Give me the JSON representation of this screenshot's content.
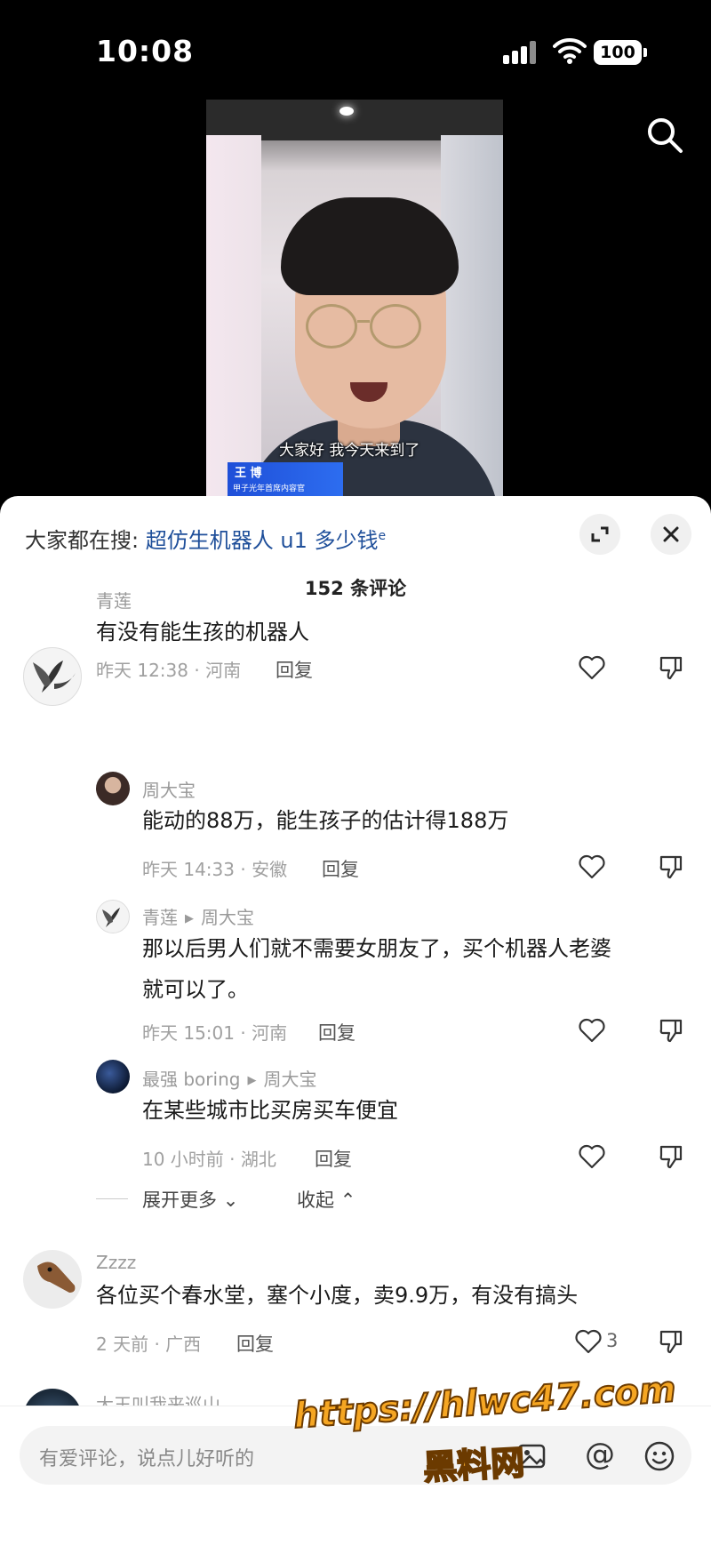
{
  "status_bar": {
    "time": "10:08",
    "battery": "100"
  },
  "video": {
    "subtitle": "大家好 我今天来到了",
    "name_tag": {
      "name": "王 博",
      "org": "甲子光年首席内容官"
    }
  },
  "sheet": {
    "hot_search_label": "大家都在搜:",
    "hot_search_keyword": "超仿生机器人 u1 多少钱",
    "comment_count": "152 条评论"
  },
  "comments": [
    {
      "user": "青莲",
      "text": "有没有能生孩的机器人",
      "meta": "昨天 12:38 · 河南",
      "reply": "回复",
      "replies": [
        {
          "user": "周大宝",
          "text": "能动的88万，能生孩子的估计得188万",
          "meta": "昨天 14:33 · 安徽",
          "reply": "回复"
        },
        {
          "user": "青莲",
          "to": "周大宝",
          "text_line1": "那以后男人们就不需要女朋友了，买个机器人老婆",
          "text_line2": "就可以了。",
          "meta": "昨天 15:01 · 河南",
          "reply": "回复"
        },
        {
          "user": "最强 boring",
          "to": "周大宝",
          "text": "在某些城市比买房买车便宜",
          "meta": "10 小时前 · 湖北",
          "reply": "回复"
        }
      ],
      "expand_more": "展开更多",
      "collapse": "收起"
    },
    {
      "user": "Zzzz",
      "text": "各位买个春水堂，塞个小度，卖9.9万，有没有搞头",
      "meta": "2 天前 · 广西",
      "reply": "回复",
      "likes": "3"
    },
    {
      "user": "大王叫我来巡山"
    }
  ],
  "input_bar": {
    "placeholder": "有爱评论，说点儿好听的",
    "at_symbol": "@"
  },
  "watermark": {
    "url": "https://hlwc47.com",
    "name": "黑料网"
  },
  "icons": {
    "search": "search-icon",
    "expand": "expand-icon",
    "close": "close-icon",
    "like": "heart-icon",
    "dislike": "thumbs-down-icon",
    "image": "image-icon",
    "emoji": "emoji-icon"
  },
  "colors": {
    "keyword": "#1f4f9a",
    "watermark": "#f5a623",
    "meta": "#a0a0a0"
  }
}
